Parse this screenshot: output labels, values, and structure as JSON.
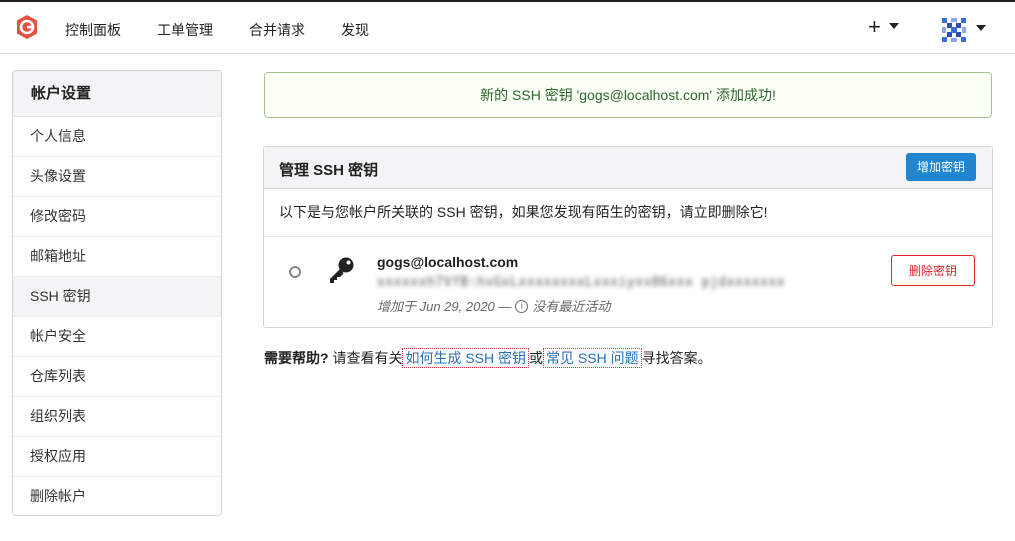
{
  "nav": {
    "logo": "gogs-logo",
    "items": [
      "控制面板",
      "工单管理",
      "合并请求",
      "发现"
    ],
    "plus": "+"
  },
  "sidebar": {
    "header": "帐户设置",
    "items": [
      {
        "label": "个人信息"
      },
      {
        "label": "头像设置"
      },
      {
        "label": "修改密码"
      },
      {
        "label": "邮箱地址"
      },
      {
        "label": "SSH 密钥",
        "active": true
      },
      {
        "label": "帐户安全"
      },
      {
        "label": "仓库列表"
      },
      {
        "label": "组织列表"
      },
      {
        "label": "授权应用"
      },
      {
        "label": "删除帐户"
      }
    ]
  },
  "flash": {
    "message": "新的 SSH 密钥 'gogs@localhost.com' 添加成功!"
  },
  "panel": {
    "title": "管理 SSH 密钥",
    "add_button": "增加密钥",
    "description": "以下是与您帐户所关联的 SSH 密钥，如果您发现有陌生的密钥，请立即删除它!",
    "key": {
      "name": "gogs@localhost.com",
      "fingerprint": "xxxxxxh7VfB:hxGxLxxxxxxxxLxxxiyxv86xxx pjdxxxxxxx",
      "added": "增加于 Jun 29, 2020 —",
      "activity": "没有最近活动",
      "delete_button": "删除密钥"
    }
  },
  "help": {
    "prefix": "需要帮助?",
    "text1": "请查看有关",
    "link1": "如何生成 SSH 密钥",
    "or": "或",
    "link2": "常见 SSH 问题",
    "suffix": "寻找答案。"
  },
  "colors": {
    "primary": "#2185d0",
    "danger": "#db2828",
    "success_text": "#2c662d",
    "success_bg": "#fcfff5",
    "success_border": "#a3c293"
  }
}
